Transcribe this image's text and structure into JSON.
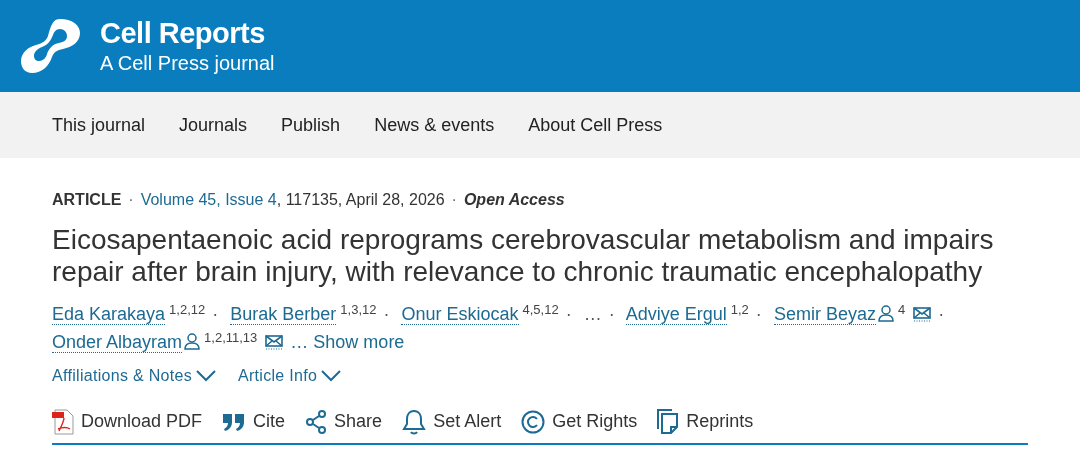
{
  "header": {
    "journal": "Cell Reports",
    "tagline": "A Cell Press journal"
  },
  "nav": [
    "This journal",
    "Journals",
    "Publish",
    "News & events",
    "About Cell Press"
  ],
  "meta": [
    {
      "kind": "type",
      "text": "ARTICLE"
    },
    {
      "kind": "separator",
      "text": "·"
    },
    {
      "kind": "volume",
      "text": "Volume 45, Issue 4"
    },
    {
      "kind": "details",
      "text": ", 117135, April 28, 2026"
    },
    {
      "kind": "separator",
      "text": "·"
    },
    {
      "kind": "access",
      "text": "Open Access"
    }
  ],
  "title": "Eicosapentaenoic acid reprograms cerebrovascular metabolism and impairs repair after brain injury, with relevance to chronic traumatic encephalopathy",
  "authors": [
    {
      "kind": "author",
      "name": "Eda Karakaya",
      "affiliations": "1,2,12",
      "profile_icon": false,
      "email_icon": false
    },
    {
      "kind": "separator",
      "name": "·"
    },
    {
      "kind": "author",
      "name": "Burak Berber",
      "affiliations": "1,3,12",
      "profile_icon": false,
      "email_icon": false
    },
    {
      "kind": "separator",
      "name": "·"
    },
    {
      "kind": "author",
      "name": "Onur Eskiocak",
      "affiliations": "4,5,12",
      "profile_icon": false,
      "email_icon": false
    },
    {
      "kind": "separator",
      "name": "·"
    },
    {
      "kind": "ellipsis",
      "name": "…"
    },
    {
      "kind": "separator",
      "name": "·"
    },
    {
      "kind": "author",
      "name": "Adviye Ergul",
      "affiliations": "1,2",
      "profile_icon": false,
      "email_icon": false
    },
    {
      "kind": "separator",
      "name": "·"
    },
    {
      "kind": "author",
      "name": "Semir Beyaz",
      "affiliations": "4",
      "profile_icon": true,
      "email_icon": true
    },
    {
      "kind": "separator",
      "name": "·"
    },
    {
      "kind": "author",
      "name": "Onder Albayram",
      "affiliations": "1,2,11,13",
      "profile_icon": true,
      "email_icon": true
    }
  ],
  "show_more": "… Show more",
  "expanders": [
    "Affiliations & Notes",
    "Article Info"
  ],
  "actions": [
    {
      "kind": "pdf",
      "label": "Download PDF"
    },
    {
      "kind": "cite",
      "label": "Cite"
    },
    {
      "kind": "share",
      "label": "Share"
    },
    {
      "kind": "alert",
      "label": "Set Alert"
    },
    {
      "kind": "rights",
      "label": "Get Rights"
    },
    {
      "kind": "reprints",
      "label": "Reprints"
    }
  ]
}
